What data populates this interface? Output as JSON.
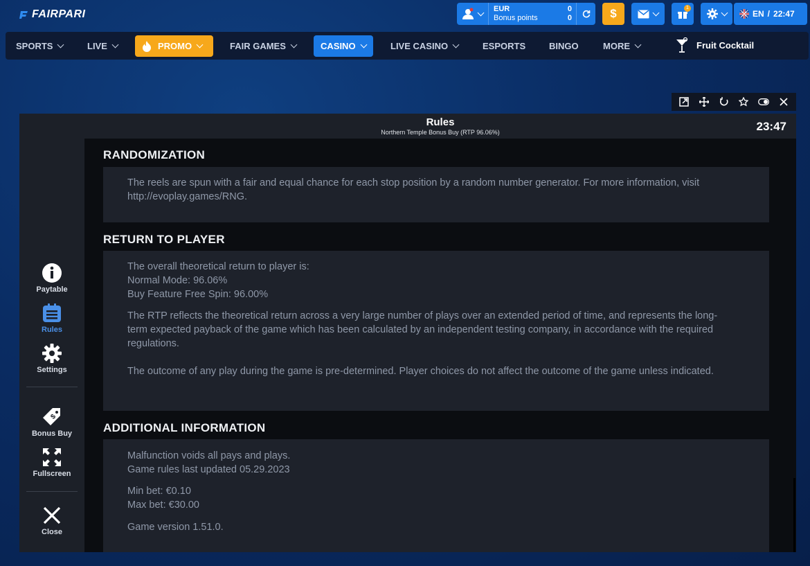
{
  "brand": {
    "name": "FAIRPARI"
  },
  "wallet": {
    "currency": "EUR",
    "bonus_label": "Bonus points",
    "balance": "0",
    "bonus": "0"
  },
  "actions": {
    "deposit_symbol": "$",
    "gift_count": "1"
  },
  "language": {
    "code": "EN",
    "time": "22:47"
  },
  "nav": [
    {
      "label": "SPORTS"
    },
    {
      "label": "LIVE"
    },
    {
      "label": "PROMO"
    },
    {
      "label": "FAIR GAMES"
    },
    {
      "label": "CASINO"
    },
    {
      "label": "LIVE CASINO"
    },
    {
      "label": "ESPORTS"
    },
    {
      "label": "BINGO"
    },
    {
      "label": "MORE"
    }
  ],
  "game_title_nav": "Fruit Cocktail",
  "game": {
    "header_title": "Rules",
    "header_subtitle": "Northern Temple Bonus Buy (RTP 96.06%)",
    "clock": "23:47",
    "sidebar": {
      "paytable": "Paytable",
      "rules": "Rules",
      "settings": "Settings",
      "bonus_buy": "Bonus Buy",
      "fullscreen": "Fullscreen",
      "close": "Close"
    },
    "sections": {
      "randomization": {
        "title": "RANDOMIZATION",
        "text": "The reels are spun with a fair and equal chance for each stop position by a random number generator. For more information, visit http://evoplay.games/RNG."
      },
      "rtp": {
        "title": "RETURN TO PLAYER",
        "line1": "The overall theoretical return to player is:",
        "line2": "Normal Mode: 96.06%",
        "line3": "Buy Feature Free Spin: 96.00%",
        "para1": "The RTP reflects the theoretical return across a very large number of plays over an extended period of time, and represents the long-term expected payback of the game which has been calculated by an independent testing company, in accordance with the required regulations.",
        "para2": "The outcome of any play during the game is pre-determined. Player choices do not affect the outcome of the game unless indicated."
      },
      "additional": {
        "title": "ADDITIONAL INFORMATION",
        "line1": "Malfunction voids all pays and plays.",
        "line2": "Game rules last updated 05.29.2023",
        "line3": "Min bet: €0.10",
        "line4": "Max bet: €30.00",
        "line5": "Game version 1.51.0."
      }
    }
  },
  "colors": {
    "accent_blue": "#1b7ae6",
    "accent_orange": "#f7a81b",
    "panel": "#1e222b",
    "text_muted": "#8f98a8"
  }
}
